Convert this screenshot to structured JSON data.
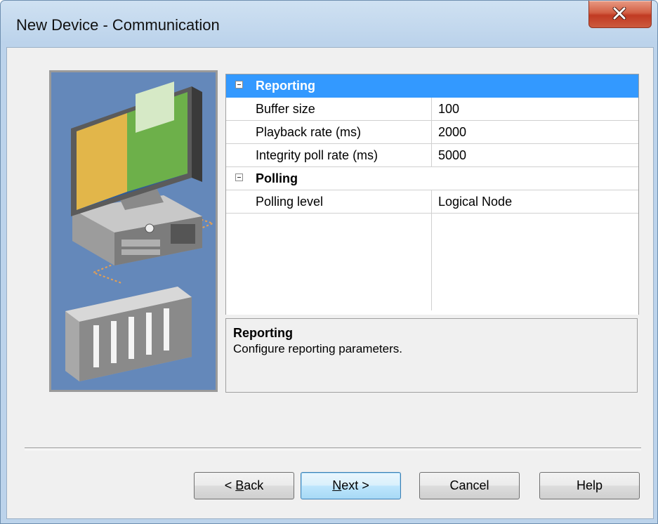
{
  "window": {
    "title": "New Device - Communication"
  },
  "grid": {
    "categories": [
      {
        "label": "Reporting",
        "selected": true,
        "properties": [
          {
            "name": "Buffer size",
            "value": "100"
          },
          {
            "name": "Playback rate (ms)",
            "value": "2000"
          },
          {
            "name": "Integrity poll rate (ms)",
            "value": "5000"
          }
        ]
      },
      {
        "label": "Polling",
        "selected": false,
        "properties": [
          {
            "name": "Polling level",
            "value": "Logical Node"
          }
        ]
      }
    ]
  },
  "description": {
    "title": "Reporting",
    "text": "Configure reporting parameters."
  },
  "buttons": {
    "back_prefix": "< ",
    "back_mnemonic": "B",
    "back_rest": "ack",
    "next_mnemonic": "N",
    "next_rest": "ext >",
    "cancel": "Cancel",
    "help": "Help"
  },
  "colors": {
    "selection": "#3399ff",
    "illustration_bg": "#6488ba",
    "close_button": "#c9462c"
  }
}
